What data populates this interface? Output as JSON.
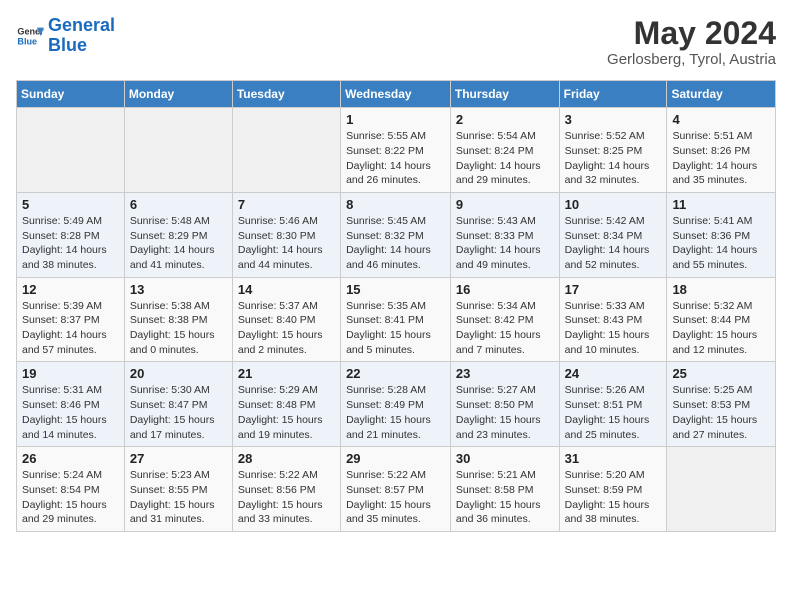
{
  "logo": {
    "line1": "General",
    "line2": "Blue"
  },
  "title": "May 2024",
  "location": "Gerlosberg, Tyrol, Austria",
  "days_of_week": [
    "Sunday",
    "Monday",
    "Tuesday",
    "Wednesday",
    "Thursday",
    "Friday",
    "Saturday"
  ],
  "weeks": [
    [
      {
        "day": "",
        "info": ""
      },
      {
        "day": "",
        "info": ""
      },
      {
        "day": "",
        "info": ""
      },
      {
        "day": "1",
        "info": "Sunrise: 5:55 AM\nSunset: 8:22 PM\nDaylight: 14 hours and 26 minutes."
      },
      {
        "day": "2",
        "info": "Sunrise: 5:54 AM\nSunset: 8:24 PM\nDaylight: 14 hours and 29 minutes."
      },
      {
        "day": "3",
        "info": "Sunrise: 5:52 AM\nSunset: 8:25 PM\nDaylight: 14 hours and 32 minutes."
      },
      {
        "day": "4",
        "info": "Sunrise: 5:51 AM\nSunset: 8:26 PM\nDaylight: 14 hours and 35 minutes."
      }
    ],
    [
      {
        "day": "5",
        "info": "Sunrise: 5:49 AM\nSunset: 8:28 PM\nDaylight: 14 hours and 38 minutes."
      },
      {
        "day": "6",
        "info": "Sunrise: 5:48 AM\nSunset: 8:29 PM\nDaylight: 14 hours and 41 minutes."
      },
      {
        "day": "7",
        "info": "Sunrise: 5:46 AM\nSunset: 8:30 PM\nDaylight: 14 hours and 44 minutes."
      },
      {
        "day": "8",
        "info": "Sunrise: 5:45 AM\nSunset: 8:32 PM\nDaylight: 14 hours and 46 minutes."
      },
      {
        "day": "9",
        "info": "Sunrise: 5:43 AM\nSunset: 8:33 PM\nDaylight: 14 hours and 49 minutes."
      },
      {
        "day": "10",
        "info": "Sunrise: 5:42 AM\nSunset: 8:34 PM\nDaylight: 14 hours and 52 minutes."
      },
      {
        "day": "11",
        "info": "Sunrise: 5:41 AM\nSunset: 8:36 PM\nDaylight: 14 hours and 55 minutes."
      }
    ],
    [
      {
        "day": "12",
        "info": "Sunrise: 5:39 AM\nSunset: 8:37 PM\nDaylight: 14 hours and 57 minutes."
      },
      {
        "day": "13",
        "info": "Sunrise: 5:38 AM\nSunset: 8:38 PM\nDaylight: 15 hours and 0 minutes."
      },
      {
        "day": "14",
        "info": "Sunrise: 5:37 AM\nSunset: 8:40 PM\nDaylight: 15 hours and 2 minutes."
      },
      {
        "day": "15",
        "info": "Sunrise: 5:35 AM\nSunset: 8:41 PM\nDaylight: 15 hours and 5 minutes."
      },
      {
        "day": "16",
        "info": "Sunrise: 5:34 AM\nSunset: 8:42 PM\nDaylight: 15 hours and 7 minutes."
      },
      {
        "day": "17",
        "info": "Sunrise: 5:33 AM\nSunset: 8:43 PM\nDaylight: 15 hours and 10 minutes."
      },
      {
        "day": "18",
        "info": "Sunrise: 5:32 AM\nSunset: 8:44 PM\nDaylight: 15 hours and 12 minutes."
      }
    ],
    [
      {
        "day": "19",
        "info": "Sunrise: 5:31 AM\nSunset: 8:46 PM\nDaylight: 15 hours and 14 minutes."
      },
      {
        "day": "20",
        "info": "Sunrise: 5:30 AM\nSunset: 8:47 PM\nDaylight: 15 hours and 17 minutes."
      },
      {
        "day": "21",
        "info": "Sunrise: 5:29 AM\nSunset: 8:48 PM\nDaylight: 15 hours and 19 minutes."
      },
      {
        "day": "22",
        "info": "Sunrise: 5:28 AM\nSunset: 8:49 PM\nDaylight: 15 hours and 21 minutes."
      },
      {
        "day": "23",
        "info": "Sunrise: 5:27 AM\nSunset: 8:50 PM\nDaylight: 15 hours and 23 minutes."
      },
      {
        "day": "24",
        "info": "Sunrise: 5:26 AM\nSunset: 8:51 PM\nDaylight: 15 hours and 25 minutes."
      },
      {
        "day": "25",
        "info": "Sunrise: 5:25 AM\nSunset: 8:53 PM\nDaylight: 15 hours and 27 minutes."
      }
    ],
    [
      {
        "day": "26",
        "info": "Sunrise: 5:24 AM\nSunset: 8:54 PM\nDaylight: 15 hours and 29 minutes."
      },
      {
        "day": "27",
        "info": "Sunrise: 5:23 AM\nSunset: 8:55 PM\nDaylight: 15 hours and 31 minutes."
      },
      {
        "day": "28",
        "info": "Sunrise: 5:22 AM\nSunset: 8:56 PM\nDaylight: 15 hours and 33 minutes."
      },
      {
        "day": "29",
        "info": "Sunrise: 5:22 AM\nSunset: 8:57 PM\nDaylight: 15 hours and 35 minutes."
      },
      {
        "day": "30",
        "info": "Sunrise: 5:21 AM\nSunset: 8:58 PM\nDaylight: 15 hours and 36 minutes."
      },
      {
        "day": "31",
        "info": "Sunrise: 5:20 AM\nSunset: 8:59 PM\nDaylight: 15 hours and 38 minutes."
      },
      {
        "day": "",
        "info": ""
      }
    ]
  ]
}
